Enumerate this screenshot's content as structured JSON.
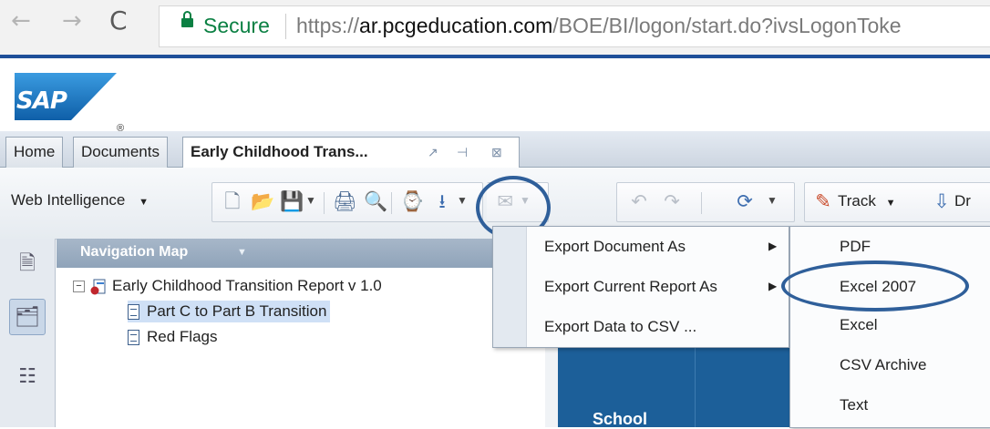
{
  "browser": {
    "back_glyph": "←",
    "forward_glyph": "→",
    "reload_glyph": "C",
    "secure_label": "Secure",
    "url_scheme": "https://",
    "url_host": "ar.pcgeducation.com",
    "url_path": "/BOE/BI/logon/start.do?ivsLogonToke",
    "secure_color": "#0b8043"
  },
  "sap": {
    "logo_text": "SAP",
    "registered_mark": "®",
    "brand_color": "#1d6fbf"
  },
  "tabs": [
    {
      "label": "Home"
    },
    {
      "label": "Documents"
    },
    {
      "label": "Early Childhood Trans..."
    }
  ],
  "toolbar": {
    "web_intelligence_label": "Web Intelligence",
    "dropdown_glyph": "▼",
    "track_label": "Track",
    "drill_label": "Dr",
    "icons": [
      "new-document-icon",
      "open-folder-icon",
      "save-icon",
      "print-icon",
      "find-icon",
      "history-icon",
      "export-icon",
      "email-icon",
      "undo-icon",
      "redo-icon",
      "refresh-icon",
      "track-icon",
      "drill-icon"
    ]
  },
  "navigation": {
    "title": "Navigation Map",
    "caret": "▼",
    "root_label": "Early Childhood Transition Report v 1.0",
    "items": [
      {
        "label": "Part C to Part B Transition",
        "selected": true
      },
      {
        "label": "Red Flags",
        "selected": false
      }
    ]
  },
  "export_menu": {
    "items": [
      {
        "label": "Export Document As",
        "has_submenu": true
      },
      {
        "label": "Export Current Report As",
        "has_submenu": true
      },
      {
        "label": "Export Data to CSV ...",
        "has_submenu": false
      }
    ],
    "submenu_glyph": "▶"
  },
  "format_menu": {
    "items": [
      {
        "label": "PDF"
      },
      {
        "label": "Excel 2007",
        "highlighted": true
      },
      {
        "label": "Excel"
      },
      {
        "label": "CSV Archive"
      },
      {
        "label": "Text"
      }
    ]
  },
  "report": {
    "header_cell_text": "School",
    "header_color": "#1c5f99"
  },
  "highlight_color": "#2f5f9a"
}
